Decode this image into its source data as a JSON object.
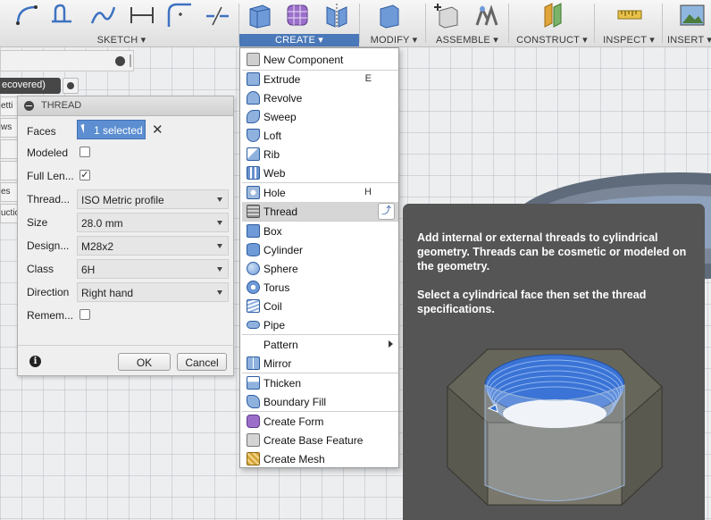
{
  "toolbar": {
    "groups": [
      {
        "label": "SKETCH",
        "active": false
      },
      {
        "label": "CREATE",
        "active": true
      },
      {
        "label": "MODIFY",
        "active": false
      },
      {
        "label": "ASSEMBLE",
        "active": false
      },
      {
        "label": "CONSTRUCT",
        "active": false
      },
      {
        "label": "INSPECT",
        "active": false
      },
      {
        "label": "INSERT",
        "active": false
      }
    ],
    "icons": [
      "arc-icon",
      "offset-icon",
      "spline-icon",
      "dimension-icon",
      "fillet-icon",
      "trim-icon",
      "box-solid-icon",
      "form-icon",
      "mirror-body-icon",
      "press-pull-icon",
      "new-joint-icon",
      "as-built-joint-icon",
      "offset-plane-icon",
      "measure-icon",
      "insert-image-icon"
    ]
  },
  "browser": {
    "item_label": "ecovered)",
    "side_tabs": [
      "etti",
      "ws",
      "",
      "",
      "es",
      "uctio"
    ]
  },
  "thread_dialog": {
    "title": "THREAD",
    "faces_label": "Faces",
    "faces_value": "1 selected",
    "modeled_label": "Modeled",
    "modeled_checked": false,
    "full_length_label": "Full Len...",
    "full_length_checked": true,
    "thread_type_label": "Thread...",
    "thread_type_value": "ISO Metric profile",
    "size_label": "Size",
    "size_value": "28.0 mm",
    "designation_label": "Design...",
    "designation_value": "M28x2",
    "class_label": "Class",
    "class_value": "6H",
    "direction_label": "Direction",
    "direction_value": "Right hand",
    "remember_label": "Remem...",
    "remember_checked": false,
    "ok_label": "OK",
    "cancel_label": "Cancel",
    "check_glyph": "✓",
    "clear_glyph": "✕"
  },
  "create_menu": {
    "items": [
      {
        "label": "New Component",
        "key": "",
        "icon": "new-component-icon",
        "color": "#c8c8c8"
      },
      {
        "label": "Extrude",
        "key": "E",
        "icon": "extrude-icon",
        "color": "#8fb1de"
      },
      {
        "label": "Revolve",
        "key": "",
        "icon": "revolve-icon",
        "color": "#8fb1de"
      },
      {
        "label": "Sweep",
        "key": "",
        "icon": "sweep-icon",
        "color": "#8fb1de"
      },
      {
        "label": "Loft",
        "key": "",
        "icon": "loft-icon",
        "color": "#8fb1de"
      },
      {
        "label": "Rib",
        "key": "",
        "icon": "rib-icon",
        "color": "#8fb1de"
      },
      {
        "label": "Web",
        "key": "",
        "icon": "web-icon",
        "color": "#6a92cf"
      },
      {
        "label": "Hole",
        "key": "H",
        "icon": "hole-icon",
        "color": "#9eb9dd"
      },
      {
        "label": "Thread",
        "key": "",
        "icon": "thread-icon",
        "color": "#8c8c8c"
      },
      {
        "label": "Box",
        "key": "",
        "icon": "box-icon",
        "color": "#6f9ad8"
      },
      {
        "label": "Cylinder",
        "key": "",
        "icon": "cylinder-icon",
        "color": "#6f9ad8"
      },
      {
        "label": "Sphere",
        "key": "",
        "icon": "sphere-icon",
        "color": "#6f9ad8"
      },
      {
        "label": "Torus",
        "key": "",
        "icon": "torus-icon",
        "color": "#6f9ad8"
      },
      {
        "label": "Coil",
        "key": "",
        "icon": "coil-icon",
        "color": "#8fb1de"
      },
      {
        "label": "Pipe",
        "key": "",
        "icon": "pipe-icon",
        "color": "#8fb1de"
      },
      {
        "label": "Pattern",
        "key": "",
        "icon": "",
        "color": ""
      },
      {
        "label": "Mirror",
        "key": "",
        "icon": "mirror-icon",
        "color": "#8fb1de"
      },
      {
        "label": "Thicken",
        "key": "",
        "icon": "thicken-icon",
        "color": "#8fb1de"
      },
      {
        "label": "Boundary Fill",
        "key": "",
        "icon": "boundary-fill-icon",
        "color": "#8fb1de"
      },
      {
        "label": "Create Form",
        "key": "",
        "icon": "create-form-icon",
        "color": "#9b6fc9"
      },
      {
        "label": "Create Base Feature",
        "key": "",
        "icon": "base-feature-icon",
        "color": "#a0a0a0"
      },
      {
        "label": "Create Mesh",
        "key": "",
        "icon": "create-mesh-icon",
        "color": "#d6a53a"
      }
    ],
    "highlighted": "Thread"
  },
  "tooltip": {
    "description": "Add internal or external threads to cylindrical geometry. Threads can be cosmetic or modeled on the geometry.",
    "instruction": "Select a cylindrical face then set the thread specifications."
  },
  "colors": {
    "accent": "#4a78b8",
    "selection": "#5c8ed1",
    "tooltip_bg": "#555555",
    "thread_blue": "#3b74d6"
  }
}
